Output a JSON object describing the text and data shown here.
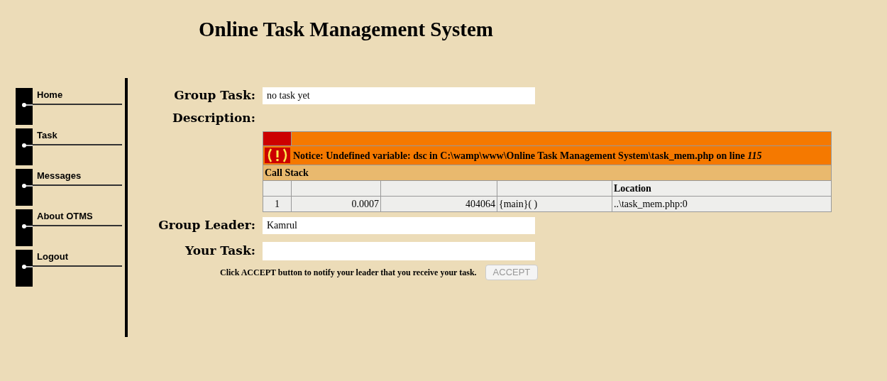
{
  "title": "Online Task Management System",
  "nav": [
    {
      "label": "Home"
    },
    {
      "label": "Task"
    },
    {
      "label": "Messages"
    },
    {
      "label": "About OTMS"
    },
    {
      "label": "Logout"
    }
  ],
  "group_task": {
    "label": "Group Task:",
    "value": "no task yet"
  },
  "description": {
    "label": "Description:"
  },
  "error": {
    "notice": "Notice: Undefined variable: dsc in C:\\wamp\\www\\Online Task Management System\\task_mem.php on line *115*",
    "call_stack": "Call Stack",
    "location_header": "Location",
    "rows": [
      [
        "1",
        "0.0007",
        "404064",
        "{main}( )",
        "..\\task_mem.php:0"
      ]
    ]
  },
  "group_leader": {
    "label": "Group Leader:",
    "value": "Kamrul"
  },
  "your_task": {
    "label": "Your Task:",
    "button": "ACCEPT",
    "disabled": true
  },
  "note": "Click ACCEPT button to notify your leader that you receive your task."
}
